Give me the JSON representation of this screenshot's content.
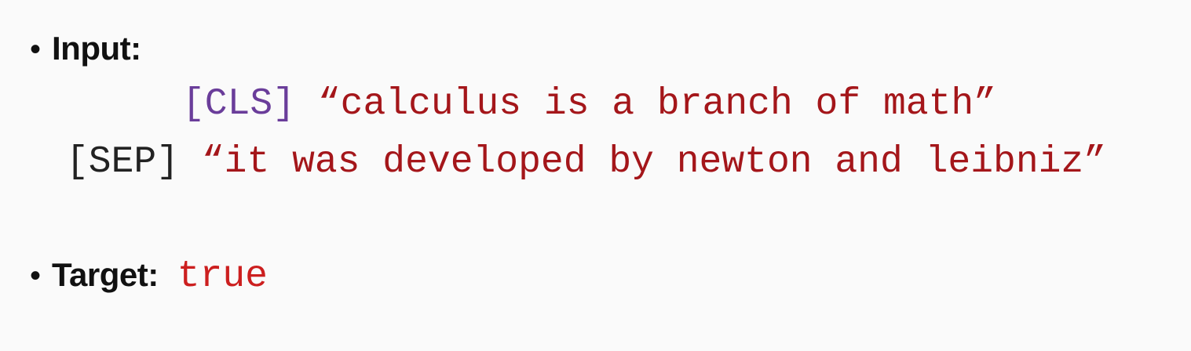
{
  "slide": {
    "input": {
      "bullet": "•",
      "label": "Input:",
      "line1": {
        "token": "[CLS]",
        "sentence": "“calculus is a branch of math”"
      },
      "line2": {
        "token": "[SEP]",
        "sentence": "“it was developed by newton and leibniz”"
      }
    },
    "target": {
      "bullet": "•",
      "label": "Target:",
      "value": "true"
    }
  },
  "colors": {
    "background": "#fafafa",
    "cls_token": "#6a3d9a",
    "sep_token": "#222222",
    "sentence": "#a4161a",
    "target_value": "#cc1f1f"
  }
}
